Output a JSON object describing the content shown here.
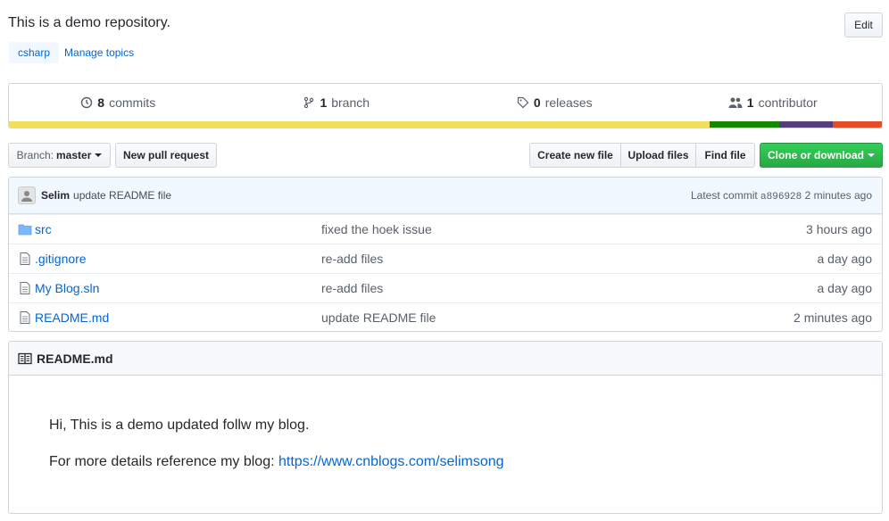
{
  "repo": {
    "description": "This is a demo repository.",
    "edit_label": "Edit",
    "topics": [
      "csharp"
    ],
    "manage_topics_label": "Manage topics"
  },
  "numbers": {
    "commits": {
      "count": "8",
      "label": "commits",
      "icon": "history-icon"
    },
    "branches": {
      "count": "1",
      "label": "branch",
      "icon": "branch-icon"
    },
    "releases": {
      "count": "0",
      "label": "releases",
      "icon": "tag-icon"
    },
    "contributors": {
      "count": "1",
      "label": "contributor",
      "icon": "people-icon"
    }
  },
  "languages": [
    {
      "color": "#f1e05a",
      "share": 80.3
    },
    {
      "color": "#178600",
      "share": 7.9
    },
    {
      "color": "#563d7c",
      "share": 6.2
    },
    {
      "color": "#e34c26",
      "share": 5.6
    }
  ],
  "toolbar": {
    "branch_prefix": "Branch:",
    "branch_name": "master",
    "new_pr_label": "New pull request",
    "create_file_label": "Create new file",
    "upload_files_label": "Upload files",
    "find_file_label": "Find file",
    "clone_label": "Clone or download"
  },
  "latest_commit": {
    "author": "Selim",
    "message": "update README file",
    "prefix": "Latest commit",
    "sha": "a896928",
    "age": "2 minutes ago"
  },
  "files": [
    {
      "type": "folder",
      "name": "src",
      "message": "fixed the hoek issue",
      "age": "3 hours ago"
    },
    {
      "type": "file",
      "name": ".gitignore",
      "message": "re-add files",
      "age": "a day ago"
    },
    {
      "type": "file",
      "name": "My Blog.sln",
      "message": "re-add files",
      "age": "a day ago"
    },
    {
      "type": "file",
      "name": "README.md",
      "message": "update README file",
      "age": "2 minutes ago"
    }
  ],
  "readme": {
    "title": "README.md",
    "line1": "Hi, This is a demo updated follw my blog.",
    "line2_prefix": "For more details reference my blog: ",
    "link_text": "https://www.cnblogs.com/selimsong"
  },
  "colors": {
    "link": "#0366d6",
    "clone_green": "#28a745",
    "commit_bar_bg": "#f1f8ff"
  }
}
